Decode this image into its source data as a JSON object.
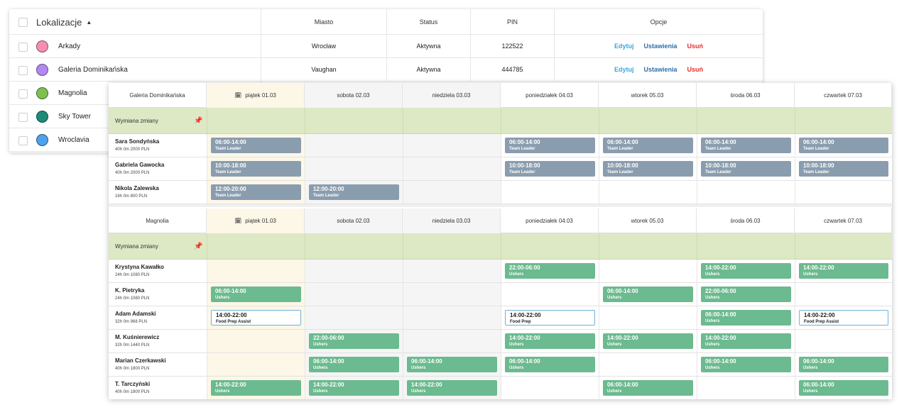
{
  "locations": {
    "title": "Lokalizacje",
    "sort_icon": "caret-up-icon",
    "headers": {
      "miasto": "Miasto",
      "status": "Status",
      "pin": "PIN",
      "opcje": "Opcje"
    },
    "rows": [
      {
        "name": "Arkady",
        "color": "#f48fb1",
        "miasto": "Wrocław",
        "status": "Aktywna",
        "pin": "122522",
        "edit": "Edytuj",
        "settings": "Ustawienia",
        "delete": "Usuń"
      },
      {
        "name": "Galeria Dominikańska",
        "color": "#b388f0",
        "miasto": "Vaughan",
        "status": "Aktywna",
        "pin": "444785",
        "edit": "Edytuj",
        "settings": "Ustawienia",
        "delete": "Usuń"
      },
      {
        "name": "Magnolia",
        "color": "#7cc150"
      },
      {
        "name": "Sky Tower",
        "color": "#1e8a7a"
      },
      {
        "name": "Wroclavia",
        "color": "#4ea1ea"
      }
    ]
  },
  "colors": {
    "grey_shift": "#8a9dae",
    "green_shift": "#6cba8f",
    "outline_shift": "#6fb2d9",
    "swap_bg": "#dce9c4",
    "today_bg": "#fdf7e8",
    "weekend_bg": "#f5f5f5"
  },
  "schedule": [
    {
      "location": "Galeria Dominikańska",
      "days": [
        "piątek 01.03",
        "sobota 02.03",
        "niedziela 03.03",
        "poniedziałek 04.03",
        "wtorek 05.03",
        "środa 06.03",
        "czwartek 07.03"
      ],
      "swap_label": "Wymiana zmiany",
      "employees": [
        {
          "name": "Sara Sondyńska",
          "meta": "40h 0m 2000 PLN",
          "shifts": [
            {
              "t": "06:00-14:00",
              "r": "Team Leader",
              "s": "grey"
            },
            null,
            null,
            {
              "t": "06:00-14:00",
              "r": "Team Leader",
              "s": "grey"
            },
            {
              "t": "06:00-14:00",
              "r": "Team Leader",
              "s": "grey"
            },
            {
              "t": "06:00-14:00",
              "r": "Team Leader",
              "s": "grey"
            },
            {
              "t": "06:00-14:00",
              "r": "Team Leader",
              "s": "grey"
            }
          ]
        },
        {
          "name": "Gabriela Gawocka",
          "meta": "40h 0m 2000 PLN",
          "shifts": [
            {
              "t": "10:00-18:00",
              "r": "Team Leader",
              "s": "grey"
            },
            null,
            null,
            {
              "t": "10:00-18:00",
              "r": "Team Leader",
              "s": "grey"
            },
            {
              "t": "10:00-18:00",
              "r": "Team Leader",
              "s": "grey"
            },
            {
              "t": "10:00-18:00",
              "r": "Team Leader",
              "s": "grey"
            },
            {
              "t": "10:00-18:00",
              "r": "Team Leader",
              "s": "grey"
            }
          ]
        },
        {
          "name": "Nikola Zalewska",
          "meta": "16h 0m 800 PLN",
          "shifts": [
            {
              "t": "12:00-20:00",
              "r": "Team Leader",
              "s": "grey"
            },
            {
              "t": "12:00-20:00",
              "r": "Team Leader",
              "s": "grey"
            },
            null,
            null,
            null,
            null,
            null
          ]
        }
      ]
    },
    {
      "location": "Magnolia",
      "days": [
        "piątek 01.03",
        "sobota 02.03",
        "niedziela 03.03",
        "poniedziałek 04.03",
        "wtorek 05.03",
        "środa 06.03",
        "czwartek 07.03"
      ],
      "swap_label": "Wymiana zmiany",
      "employees": [
        {
          "name": "Krystyna Kawałko",
          "meta": "24h 0m 1080 PLN",
          "shifts": [
            null,
            null,
            null,
            {
              "t": "22:00-06:00",
              "r": "Ushers",
              "s": "green"
            },
            null,
            {
              "t": "14:00-22:00",
              "r": "Ushers",
              "s": "green"
            },
            {
              "t": "14:00-22:00",
              "r": "Ushers",
              "s": "green"
            }
          ]
        },
        {
          "name": "K. Pietryka",
          "meta": "24h 0m 1080 PLN",
          "shifts": [
            {
              "t": "06:00-14:00",
              "r": "Ushers",
              "s": "green"
            },
            null,
            null,
            null,
            {
              "t": "06:00-14:00",
              "r": "Ushers",
              "s": "green"
            },
            {
              "t": "22:00-06:00",
              "r": "Ushers",
              "s": "green"
            },
            null
          ]
        },
        {
          "name": "Adam Adamski",
          "meta": "32h 0m 968 PLN",
          "shifts": [
            {
              "t": "14:00-22:00",
              "r": "Food Prep Assist",
              "s": "outline"
            },
            null,
            null,
            {
              "t": "14:00-22:00",
              "r": "Food Prep",
              "s": "outline"
            },
            null,
            {
              "t": "06:00-14:00",
              "r": "Ushers",
              "s": "green"
            },
            {
              "t": "14:00-22:00",
              "r": "Food Prep Assist",
              "s": "outline"
            }
          ]
        },
        {
          "name": "M. Kuśnierewicz",
          "meta": "32h 0m 1440 PLN",
          "shifts": [
            null,
            {
              "t": "22:00-06:00",
              "r": "Ushers",
              "s": "green"
            },
            null,
            {
              "t": "14:00-22:00",
              "r": "Ushers",
              "s": "green"
            },
            {
              "t": "14:00-22:00",
              "r": "Ushers",
              "s": "green"
            },
            {
              "t": "14:00-22:00",
              "r": "Ushers",
              "s": "green"
            },
            null
          ]
        },
        {
          "name": "Marian Czerkawski",
          "meta": "40h 0m 1800 PLN",
          "shifts": [
            null,
            {
              "t": "06:00-14:00",
              "r": "Ushers",
              "s": "green"
            },
            {
              "t": "06:00-14:00",
              "r": "Ushers",
              "s": "green"
            },
            {
              "t": "06:00-14:00",
              "r": "Ushers",
              "s": "green"
            },
            null,
            {
              "t": "06:00-14:00",
              "r": "Ushers",
              "s": "green"
            },
            {
              "t": "06:00-14:00",
              "r": "Ushers",
              "s": "green"
            }
          ]
        },
        {
          "name": "T. Tarczyński",
          "meta": "40h 0m 1800 PLN",
          "shifts": [
            {
              "t": "14:00-22:00",
              "r": "Ushers",
              "s": "green"
            },
            {
              "t": "14:00-22:00",
              "r": "Ushers",
              "s": "green"
            },
            {
              "t": "14:00-22:00",
              "r": "Ushers",
              "s": "green"
            },
            null,
            {
              "t": "06:00-14:00",
              "r": "Ushers",
              "s": "green"
            },
            null,
            {
              "t": "06:00-14:00",
              "r": "Ushers",
              "s": "green"
            }
          ]
        }
      ]
    }
  ]
}
